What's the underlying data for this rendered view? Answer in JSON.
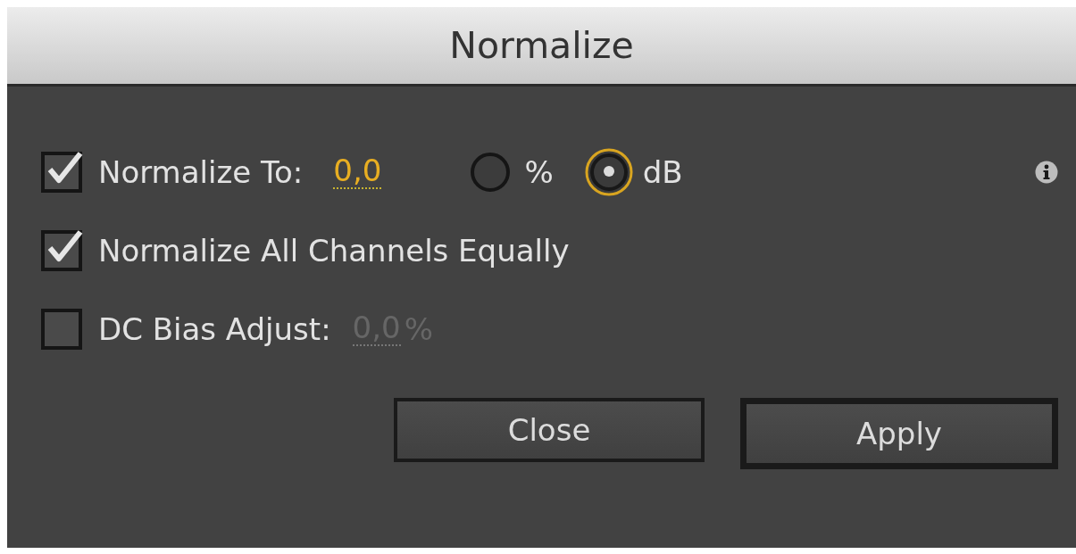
{
  "window": {
    "title": "Normalize"
  },
  "normalize_to": {
    "label": "Normalize To:",
    "checked": true,
    "value": "0,0",
    "units": [
      {
        "label": "%",
        "selected": false
      },
      {
        "label": "dB",
        "selected": true
      }
    ]
  },
  "normalize_all_channels": {
    "label": "Normalize All Channels Equally",
    "checked": true
  },
  "dc_bias_adjust": {
    "label": "DC Bias Adjust:",
    "checked": false,
    "value": "0,0",
    "unit": "%",
    "disabled": true
  },
  "buttons": [
    {
      "label": "Close",
      "default": false
    },
    {
      "label": "Apply",
      "default": true
    }
  ]
}
